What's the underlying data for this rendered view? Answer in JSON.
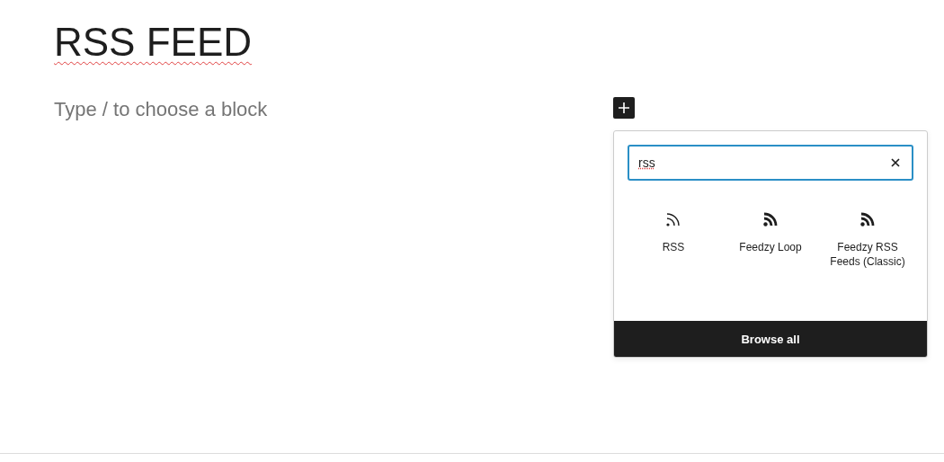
{
  "title": "RSS FEED",
  "placeholder": "Type / to choose a block",
  "inserter": {
    "search": {
      "value": "rss"
    },
    "results": [
      {
        "label": "RSS",
        "kind": "outline"
      },
      {
        "label": "Feedzy Loop",
        "kind": "bold"
      },
      {
        "label": "Feedzy RSS Feeds (Classic)",
        "kind": "bold"
      }
    ],
    "browse": "Browse all"
  }
}
